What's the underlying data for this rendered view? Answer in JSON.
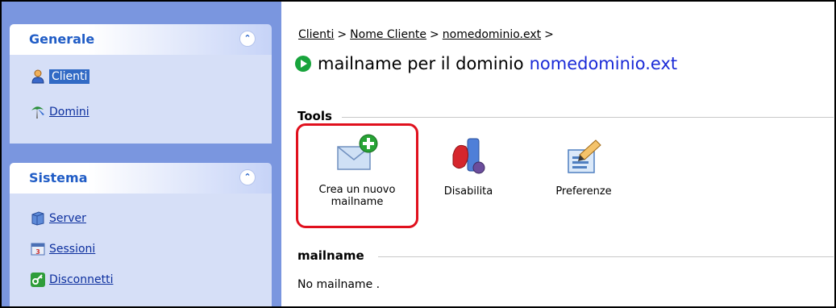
{
  "sidebar": {
    "panels": [
      {
        "title": "Generale",
        "collapse_icon": "chevron-up-double-icon",
        "items": [
          {
            "label": "Clienti",
            "icon": "user-icon",
            "active": true
          },
          {
            "label": "Domini",
            "icon": "domain-icon",
            "active": false
          }
        ]
      },
      {
        "title": "Sistema",
        "collapse_icon": "chevron-up-double-icon",
        "items": [
          {
            "label": "Server",
            "icon": "server-icon"
          },
          {
            "label": "Sessioni",
            "icon": "sessions-icon"
          },
          {
            "label": "Disconnetti",
            "icon": "logout-icon"
          }
        ]
      }
    ]
  },
  "breadcrumb": {
    "items": [
      "Clienti",
      "Nome Cliente",
      "nomedominio.ext"
    ],
    "separator": ">"
  },
  "page": {
    "title_prefix": "mailname per il dominio",
    "title_domain": "nomedominio.ext"
  },
  "tools": {
    "legend": "Tools",
    "items": [
      {
        "label_line1": "Crea un nuovo",
        "label_line2": "mailname",
        "icon": "new-mail-icon",
        "highlighted": true
      },
      {
        "label_line1": "Disabilita",
        "label_line2": "",
        "icon": "disable-icon"
      },
      {
        "label_line1": "Preferenze",
        "label_line2": "",
        "icon": "preferences-icon"
      }
    ]
  },
  "mailname_section": {
    "legend": "mailname",
    "empty_message": "No mailname ."
  },
  "colors": {
    "sidebar_bg": "#7a96df",
    "panel_body": "#d6dff7",
    "panel_title": "#215dc6",
    "link": "#0c2f9e",
    "active_bg": "#316ac5",
    "domain_text": "#1a2ad7",
    "highlight_border": "#e0101d"
  }
}
